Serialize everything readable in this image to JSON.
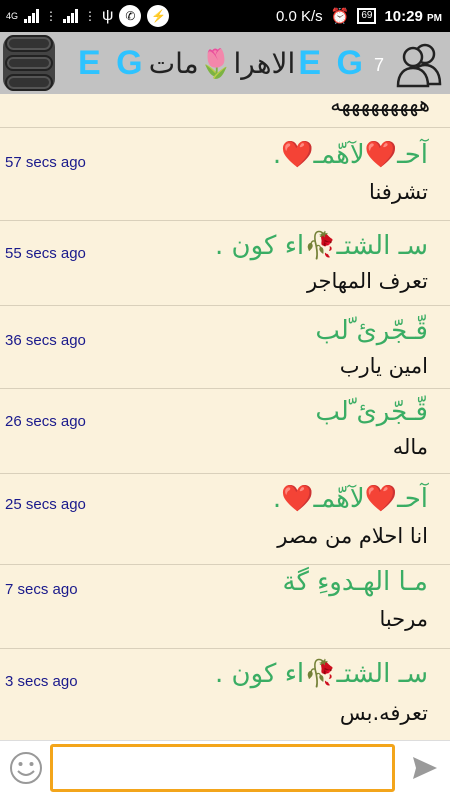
{
  "status_bar": {
    "network_type": "4G",
    "speed": "0.0 K/s",
    "battery": "69",
    "time": "10:29",
    "ampm": "PM"
  },
  "header": {
    "title_left": "E G",
    "room_name": "الاهرا🌷مات",
    "title_right": "E G",
    "online_count": "7"
  },
  "messages": [
    {
      "time": "",
      "name": "",
      "text": "هههههههههه"
    },
    {
      "time": "57 secs ago",
      "name": "آحـ❤️لآهّمـ❤️.",
      "text": "تشرفنا"
    },
    {
      "time": "55 secs ago",
      "name": "سـ الشتـ🥀اء كون .",
      "text": "تعرف المهاجر"
    },
    {
      "time": "36 secs ago",
      "name": "قّـجّرئ ّلب",
      "text": "امين يارب"
    },
    {
      "time": "26 secs ago",
      "name": "قّـجّرئ ّلب",
      "text": "ماله"
    },
    {
      "time": "25 secs ago",
      "name": "آحـ❤️لآهّمـ❤️.",
      "text": "انا احلام من مصر"
    },
    {
      "time": "7 secs ago",
      "name": "مـا الهـدوءِ گة",
      "text": "مرحبا"
    },
    {
      "time": "3 secs ago",
      "name": "سـ الشتـ🥀اء كون .",
      "text": "تعرفه.بس"
    }
  ],
  "composer": {
    "value": ""
  },
  "colors": {
    "background": "#fbf2dc",
    "header": "#c2c2c2",
    "name_green": "#3aad64",
    "time_blue": "#1a1a8c",
    "input_border": "#f3a51b",
    "title_blue": "#2ec3ff"
  }
}
